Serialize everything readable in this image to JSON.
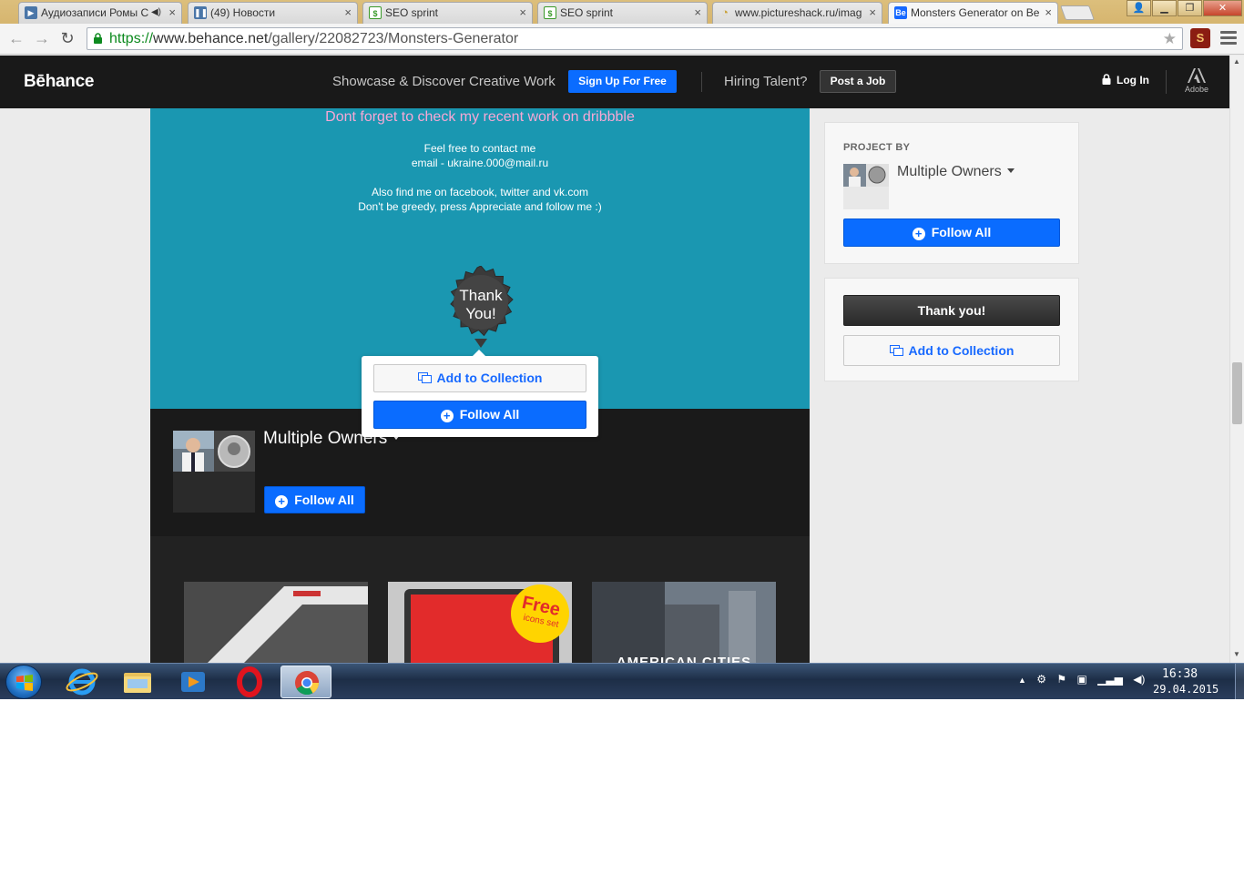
{
  "browser": {
    "tabs": [
      {
        "title": "Аудиозаписи Ромы С",
        "favicon": "vk-audio-icon",
        "has_speaker": true,
        "active": false
      },
      {
        "title": "(49) Новости",
        "favicon": "vk-icon",
        "active": false
      },
      {
        "title": "SEO sprint",
        "favicon": "seosprint-icon",
        "active": false
      },
      {
        "title": "SEO sprint",
        "favicon": "seosprint-icon",
        "active": false
      },
      {
        "title": "www.pictureshack.ru/imag",
        "favicon": "loading-icon",
        "active": false
      },
      {
        "title": "Monsters Generator on Be",
        "favicon": "behance-icon",
        "active": true
      }
    ],
    "tab_close_glyph": "×",
    "url_scheme": "https://",
    "url_host": "www.behance.net",
    "url_path": "/gallery/22082723/Monsters-Generator",
    "extension_label": "S",
    "colors": {
      "accent": "#0a6cff",
      "teal": "#1a97b1",
      "header": "#191919"
    }
  },
  "behance_header": {
    "logo": "Bēhance",
    "tagline": "Showcase & Discover Creative Work",
    "signup_label": "Sign Up For Free",
    "hiring_label": "Hiring Talent?",
    "post_job_label": "Post a Job",
    "login_label": "Log In",
    "adobe_label": "Adobe"
  },
  "project": {
    "dribbble_line": "Dont forget to check my recent work on dribbble",
    "contact_line1": "Feel free to contact me",
    "contact_line2": "email - ukraine.000@mail.ru",
    "social_line1": "Also find me on facebook, twitter and vk.com",
    "social_line2": "Don't be greedy, press Appreciate and follow me :)",
    "thank_you_line1": "Thank",
    "thank_you_line2": "You!"
  },
  "popup": {
    "add_collection_label": "Add to Collection",
    "follow_all_label": "Follow All"
  },
  "owners_section": {
    "name": "Multiple Owners",
    "follow_all_label": "Follow All"
  },
  "thumbnails": {
    "free_badge_title": "Free",
    "free_badge_subtitle": "icons set",
    "american_cities_text": "AMERICAN CITIES"
  },
  "sidebar": {
    "project_by_label": "PROJECT BY",
    "owners_name": "Multiple Owners",
    "follow_all_label": "Follow All",
    "thank_you_label": "Thank you!",
    "add_collection_label": "Add to Collection"
  },
  "taskbar": {
    "apps": [
      "internet-explorer-icon",
      "file-explorer-icon",
      "media-player-icon",
      "opera-icon",
      "chrome-icon"
    ],
    "clock_time": "16:38",
    "clock_date": "29.04.2015"
  }
}
